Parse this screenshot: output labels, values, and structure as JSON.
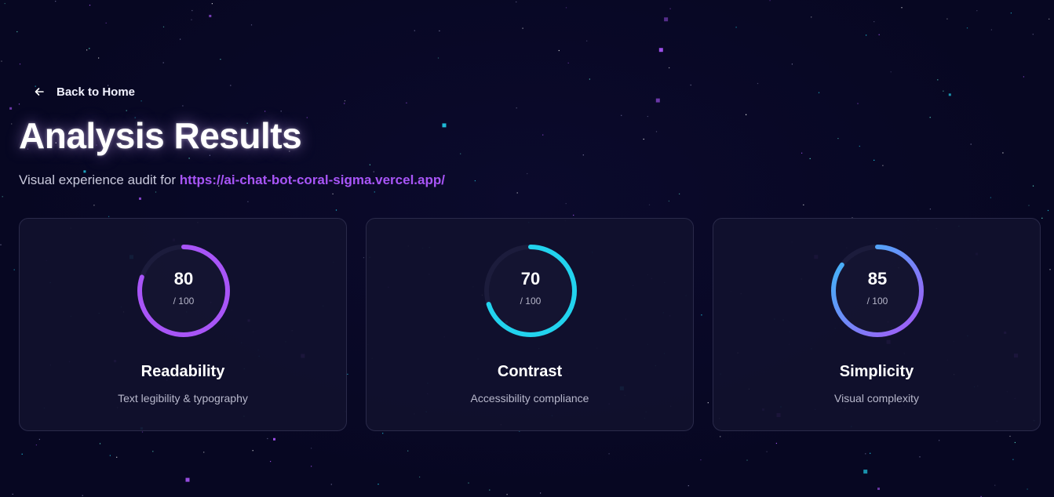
{
  "nav": {
    "back_label": "Back to Home",
    "back_icon": "arrow-left-icon"
  },
  "header": {
    "title": "Analysis Results",
    "subtitle_prefix": "Visual experience audit for",
    "url": "https://ai-chat-bot-coral-sigma.vercel.app/"
  },
  "colors": {
    "background": "#070722",
    "accent_purple": "#a855f7",
    "accent_cyan": "#22d3ee",
    "gradient_start": "#a855f7",
    "gradient_end": "#38bdf8"
  },
  "cards": [
    {
      "score": "80",
      "max": "/ 100",
      "progress": 0.8,
      "name": "Readability",
      "description": "Text legibility & typography",
      "ring_color": "#a855f7"
    },
    {
      "score": "70",
      "max": "/ 100",
      "progress": 0.7,
      "name": "Contrast",
      "description": "Accessibility compliance",
      "ring_color": "#22d3ee"
    },
    {
      "score": "85",
      "max": "/ 100",
      "progress": 0.85,
      "name": "Simplicity",
      "description": "Visual complexity",
      "ring_color": "gradient"
    }
  ]
}
